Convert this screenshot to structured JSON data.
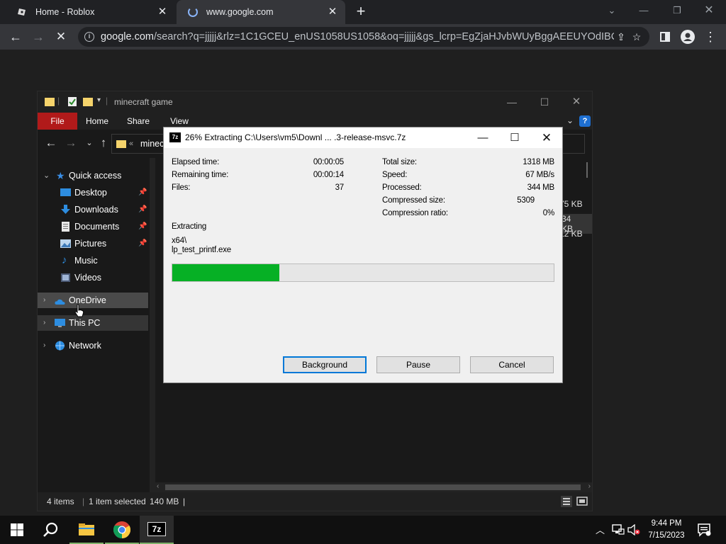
{
  "browser": {
    "tabs": [
      {
        "title": "Home - Roblox",
        "active": false
      },
      {
        "title": "www.google.com",
        "active": true
      }
    ],
    "url_host": "google.com",
    "url_path": "/search?q=jjjjj&rlz=1C1GCEU_enUS1058US1058&oq=jjjjj&gs_lcrp=EgZjaHJvbWUyBggAEEUYOdIBCD...",
    "icons": [
      "back-icon",
      "forward-icon",
      "stop-icon",
      "info-icon",
      "share-icon",
      "bookmark-star-icon",
      "side-panel-icon",
      "profile-icon",
      "menu-icon"
    ]
  },
  "explorer": {
    "title": "minecraft game",
    "ribbon_tabs": [
      "File",
      "Home",
      "Share",
      "View"
    ],
    "address": "minec",
    "nav": {
      "quick_access": "Quick access",
      "items": [
        "Desktop",
        "Downloads",
        "Documents",
        "Pictures",
        "Music",
        "Videos"
      ],
      "onedrive": "OneDrive",
      "this_pc": "This PC",
      "network": "Network"
    },
    "sizes": [
      "75 KB",
      "34 KB",
      "12 KB"
    ],
    "status": {
      "items": "4 items",
      "selected": "1 item selected",
      "size": "140 MB"
    }
  },
  "dialog": {
    "title": "26% Extracting C:\\Users\\vm5\\Downl ... .3-release-msvc.7z",
    "icon_text": "7z",
    "left_stats": [
      {
        "label": "Elapsed time:",
        "value": "00:00:05"
      },
      {
        "label": "Remaining time:",
        "value": "00:00:14"
      },
      {
        "label": "Files:",
        "value": "37"
      }
    ],
    "right_stats": [
      {
        "label": "Total size:",
        "value": "1318 MB"
      },
      {
        "label": "Speed:",
        "value": "67 MB/s"
      },
      {
        "label": "Processed:",
        "value": "344 MB"
      },
      {
        "label": "Compressed size:",
        "value": "5309"
      },
      {
        "label": "Compression ratio:",
        "value": "0%"
      }
    ],
    "status_label": "Extracting",
    "current_dir": "x64\\",
    "current_file": "lp_test_printf.exe",
    "progress": 0.28,
    "buttons": {
      "background": "Background",
      "pause": "Pause",
      "cancel": "Cancel"
    }
  },
  "taskbar": {
    "time": "9:44 PM",
    "date": "7/15/2023",
    "apps": [
      "start-icon",
      "search-icon",
      "file-explorer-icon",
      "chrome-icon",
      "7zip-icon"
    ]
  },
  "colors": {
    "progress_fill": "#06b025",
    "file_tab": "#b11a1a",
    "accent": "#0078d7"
  }
}
